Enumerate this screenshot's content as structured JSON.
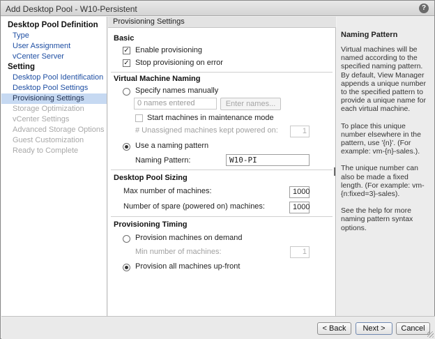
{
  "window": {
    "title": "Add Desktop Pool - W10-Persistent",
    "help_label": "?"
  },
  "nav": {
    "group1": "Desktop Pool Definition",
    "group1_items": [
      {
        "label": "Type",
        "state": "link"
      },
      {
        "label": "User Assignment",
        "state": "link"
      },
      {
        "label": "vCenter Server",
        "state": "link"
      }
    ],
    "group2": "Setting",
    "group2_items": [
      {
        "label": "Desktop Pool Identification",
        "state": "link"
      },
      {
        "label": "Desktop Pool Settings",
        "state": "link"
      },
      {
        "label": "Provisioning Settings",
        "state": "active"
      },
      {
        "label": "Storage Optimization",
        "state": "disabled"
      },
      {
        "label": "vCenter Settings",
        "state": "disabled"
      },
      {
        "label": "Advanced Storage Options",
        "state": "disabled"
      },
      {
        "label": "Guest Customization",
        "state": "disabled"
      },
      {
        "label": "Ready to Complete",
        "state": "disabled"
      }
    ]
  },
  "main": {
    "header": "Provisioning Settings",
    "basic": {
      "title": "Basic",
      "enable_label": "Enable provisioning",
      "enable_checked": true,
      "stop_label": "Stop provisioning on error",
      "stop_checked": true
    },
    "naming": {
      "title": "Virtual Machine Naming",
      "manual_label": "Specify names manually",
      "names_value": "0 names entered",
      "enter_names_button": "Enter names...",
      "maintenance_label": "Start machines in maintenance mode",
      "unassigned_label": "# Unassigned machines kept powered on:",
      "unassigned_value": "1",
      "pattern_label": "Use a naming pattern",
      "pattern_field_label": "Naming Pattern:",
      "pattern_value": "W10-PI",
      "selected": "pattern"
    },
    "sizing": {
      "title": "Desktop Pool Sizing",
      "max_label": "Max number of machines:",
      "max_value": "1000",
      "spare_label": "Number of spare (powered on) machines:",
      "spare_value": "1000"
    },
    "timing": {
      "title": "Provisioning Timing",
      "on_demand_label": "Provision machines on demand",
      "min_label": "Min number of machines:",
      "min_value": "1",
      "upfront_label": "Provision all machines up-front",
      "selected": "upfront"
    }
  },
  "help": {
    "title": "Naming Pattern",
    "p1": "Virtual machines will be named according to the specified naming pattern. By default, View Manager appends a unique number to the specified pattern to provide a unique name for each virtual machine.",
    "p2": "To place this unique number elsewhere in the pattern, use '{n}'. (For example: vm-{n}-sales.).",
    "p3": "The unique number can also be made a fixed length. (For example: vm-{n:fixed=3}-sales).",
    "p4": "See the help for more naming pattern syntax options."
  },
  "footer": {
    "back": "< Back",
    "next": "Next >",
    "cancel": "Cancel"
  },
  "check_glyph": "✓"
}
